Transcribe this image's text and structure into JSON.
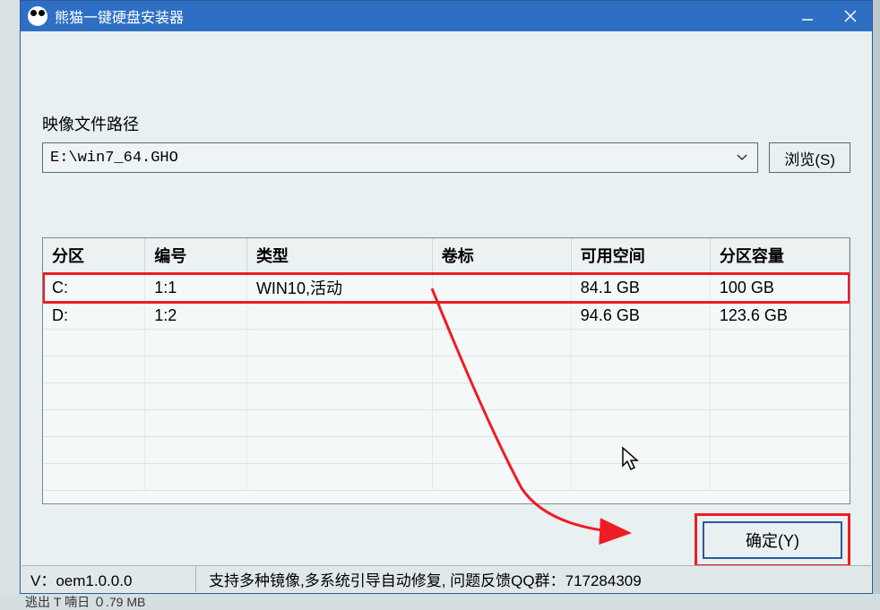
{
  "titlebar": {
    "title": "熊猫一键硬盘安装器"
  },
  "image_path": {
    "label": "映像文件路径",
    "value": "E:\\win7_64.GHO",
    "browse_label": "浏览(S)"
  },
  "table": {
    "headers": {
      "partition": "分区",
      "number": "编号",
      "type": "类型",
      "volume": "卷标",
      "free": "可用空间",
      "capacity": "分区容量"
    },
    "rows": [
      {
        "partition": "C:",
        "number": "1:1",
        "type": "WIN10,活动",
        "volume": "",
        "free": "84.1 GB",
        "capacity": "100 GB"
      },
      {
        "partition": "D:",
        "number": "1:2",
        "type": "",
        "volume": "",
        "free": "94.6 GB",
        "capacity": "123.6 GB"
      }
    ]
  },
  "buttons": {
    "ok": "确定(Y)"
  },
  "footer": {
    "version": "V：oem1.0.0.0",
    "info": "支持多种镜像,多系统引导自动修复, 问题反馈QQ群：717284309"
  },
  "background": {
    "bottom_text": "逃出 T 喃日 ０.79 MB"
  }
}
